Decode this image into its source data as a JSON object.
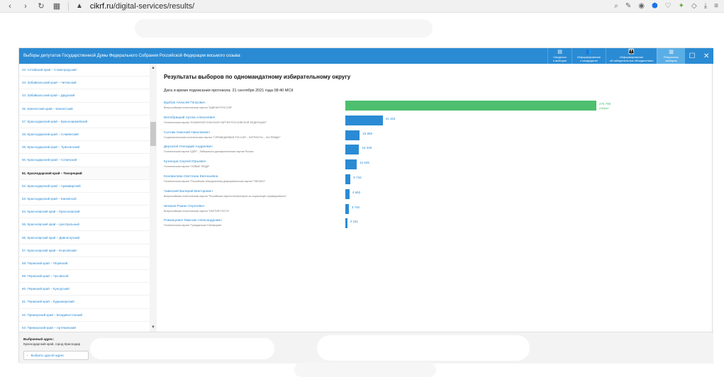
{
  "browser": {
    "url_domain": "cikrf.ru",
    "url_path": "/digital-services/results/"
  },
  "modal": {
    "title": "Выборы депутатов Государственной Думы Федерального Собрания Российской Федерации восьмого созыва",
    "tabs": [
      {
        "line1": "Сведения",
        "line2": "о выборах"
      },
      {
        "line1": "Информирование",
        "line2": "о кандидатах"
      },
      {
        "line1": "Информирование",
        "line2": "об избирательных объединениях"
      },
      {
        "line1": "Результаты",
        "line2": "выборов"
      }
    ]
  },
  "sidebar": {
    "items": [
      "42. Алтайский край – Славгородский",
      "43. Забайкальский край – Читинский",
      "44. Забайкальский край – Даурский",
      "45. Камчатский край – Камчатский",
      "47. Краснодарский край – Краснoармейский",
      "48. Краснодарский край – Славянский",
      "49. Краснодарский край – Туапсинский",
      "50. Краснодарский край – Сочинский",
      "51. Краснодарский край – Тихорецкий",
      "52. Краснодарский край – Армавирский",
      "53. Краснодарский край – Каневской",
      "54. Красноярский край – Красноярский",
      "55. Красноярский край – Центральный",
      "56. Красноярский край – Дивногорский",
      "57. Красноярский край – Енисейский",
      "58. Пермский край – Пермский",
      "59. Пермский край – Чусовской",
      "60. Пермский край – Кунгурский",
      "61. Пермский край – Кудымкарский",
      "62. Приморский край – Владивостокский",
      "63. Приморский край – Артемовский",
      "64. Приморский край – Арсеньевский",
      "65. Ставропольский край – Ставропольский"
    ],
    "selected_index": 8,
    "selected_label": "Выбранный адрес:",
    "selected_value": "Краснодарский край, город Краснодар",
    "change_button": "Выбрать другой адрес"
  },
  "results": {
    "title": "Результаты выборов по одномандатному избирательному округу",
    "date_label": "Дата и время подписания протокола: 21 сентября 2021 года 08:40 МСК",
    "elected_label": "Избран"
  },
  "chart_data": {
    "type": "bar",
    "orientation": "horizontal",
    "colors": {
      "winner": "#4dbf6e",
      "other": "#2a8bd4"
    },
    "candidates": [
      {
        "name": "Бурбов Алексей Петрович",
        "party": "Всероссийская политическая партия \"ЕДИНАЯ РОССИЯ\"",
        "value": 276780,
        "label": "276 780",
        "winner": true
      },
      {
        "name": "Белобрицкий Артем Алексеевич",
        "party": "Политическая партия \"КОММУНИСТИЧЕСКАЯ ПАРТИЯ РОССИЙСКОЙ ФЕДЕРАЦИИ\"",
        "value": 41153,
        "label": "41 153",
        "winner": false
      },
      {
        "name": "Сытник Николай Николаевич",
        "party": "Социалистическая политическая партия \"СПРАВЕДЛИВАЯ РОССИЯ – ПАТРИОТЫ – ЗА ПРАВДУ\"",
        "value": 15855,
        "label": "15 855",
        "winner": false
      },
      {
        "name": "Дергачев Геннадий Андреевич",
        "party": "Политическая партия ЛДПР – Либерально-демократическая партия России",
        "value": 15229,
        "label": "15 229",
        "winner": false
      },
      {
        "name": "Кузнецов Сергей Юрьевич",
        "party": "Политическая партия \"НОВЫЕ ЛЮДИ\"",
        "value": 12625,
        "label": "12 625",
        "winner": false
      },
      {
        "name": "Коновалова Светлана Евгеньевна",
        "party": "Политическая партия \"Российская объединенная демократическая партия \"ЯБЛОКО\"",
        "value": 5734,
        "label": "5 734",
        "winner": false
      },
      {
        "name": "Чавеский Валерий Викторович",
        "party": "Всероссийская политическая партия \"Российская партия пенсионеров за социальную справедливость\"",
        "value": 4662,
        "label": "4 662",
        "winner": false
      },
      {
        "name": "Шпаков Роман Сергеевич",
        "party": "Всероссийская политическая партия \"ПАРТИЯ РОСТА\"",
        "value": 3746,
        "label": "3 746",
        "winner": false
      },
      {
        "name": "Романцевич Максим Александрович",
        "party": "Политическая партия \"Гражданская Платформа\"",
        "value": 2151,
        "label": "2 151",
        "winner": false
      }
    ]
  }
}
